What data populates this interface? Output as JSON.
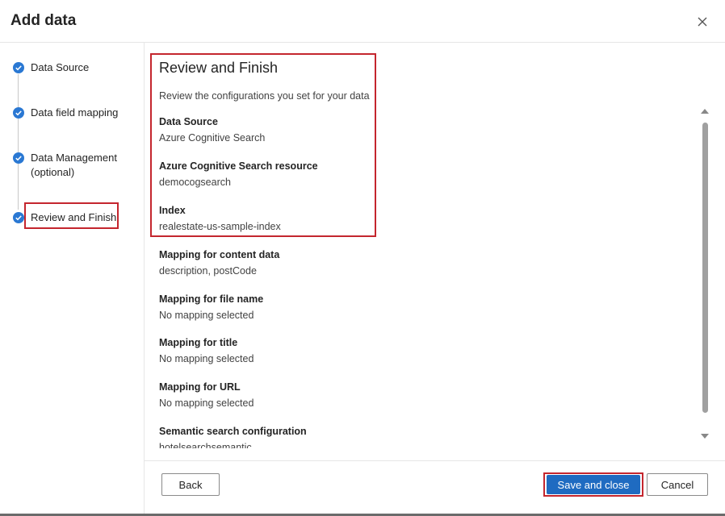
{
  "dialog": {
    "title": "Add data"
  },
  "steps": [
    {
      "label": "Data Source",
      "status": "complete"
    },
    {
      "label": "Data field mapping",
      "status": "complete"
    },
    {
      "label": "Data Management (optional)",
      "status": "complete"
    },
    {
      "label": "Review and Finish",
      "status": "current"
    }
  ],
  "main": {
    "title": "Review and Finish",
    "description": "Review the configurations you set for your data",
    "sections": [
      {
        "heading": "Data Source",
        "value": "Azure Cognitive Search"
      },
      {
        "heading": "Azure Cognitive Search resource",
        "value": "democogsearch"
      },
      {
        "heading": "Index",
        "value": "realestate-us-sample-index"
      },
      {
        "heading": "Mapping for content data",
        "value": "description, postCode"
      },
      {
        "heading": "Mapping for file name",
        "value": "No mapping selected"
      },
      {
        "heading": "Mapping for title",
        "value": "No mapping selected"
      },
      {
        "heading": "Mapping for URL",
        "value": "No mapping selected"
      },
      {
        "heading": "Semantic search configuration",
        "value": "hotelsearchsemantic"
      }
    ]
  },
  "footer": {
    "back_label": "Back",
    "save_label": "Save and close",
    "cancel_label": "Cancel"
  },
  "colors": {
    "accent": "#1f6bc1",
    "highlight": "#c4262e",
    "step_complete": "#2a78d3"
  },
  "icons": {
    "close": "close-icon",
    "step": "check-circle-icon"
  }
}
